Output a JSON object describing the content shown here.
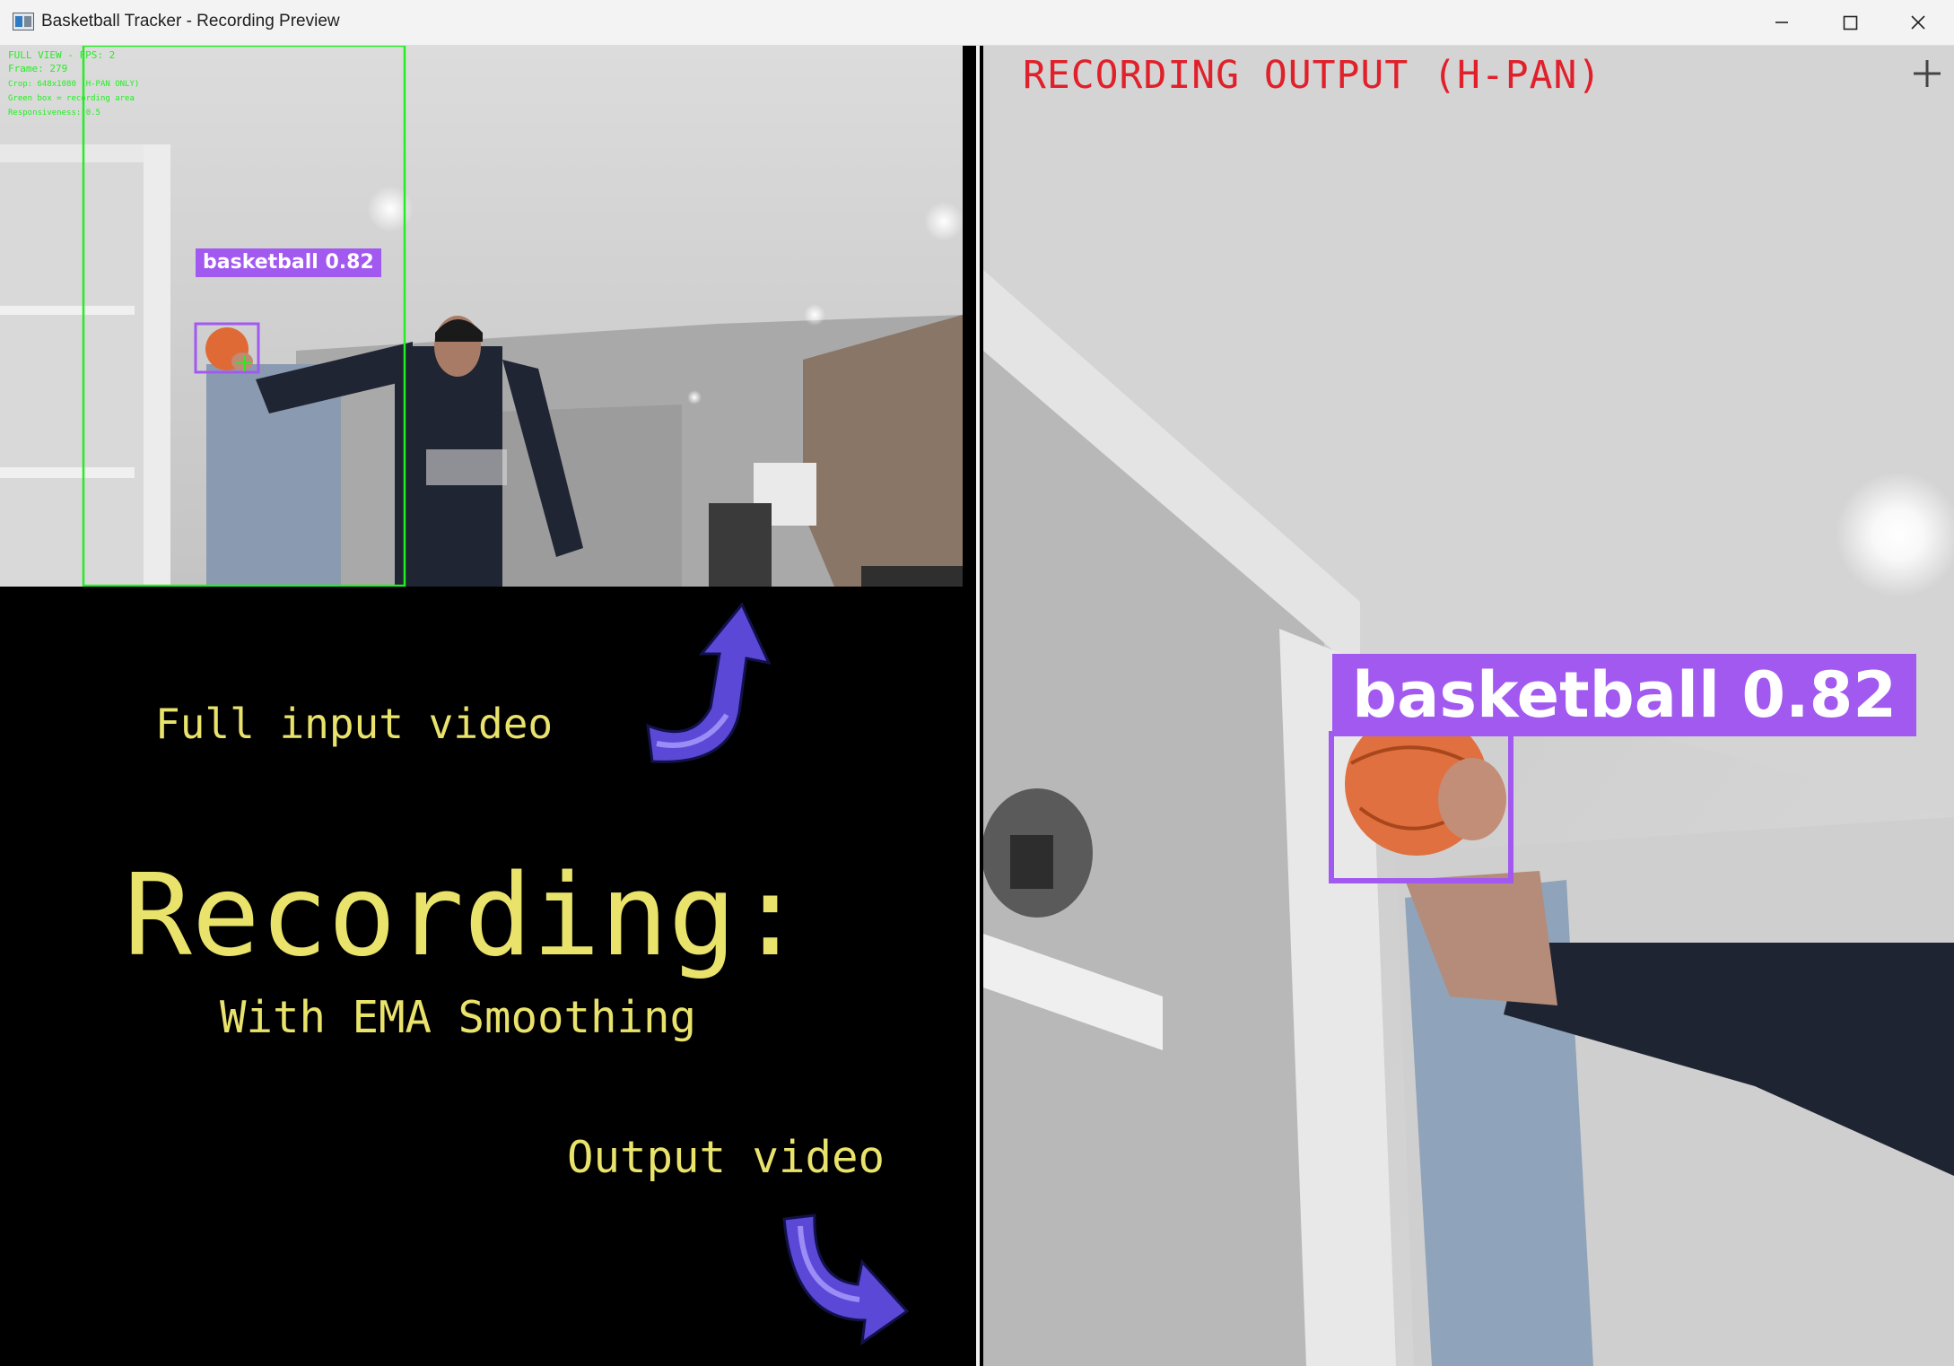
{
  "window": {
    "title": "Basketball Tracker - Recording Preview",
    "controls": [
      "minimize",
      "maximize",
      "close"
    ]
  },
  "left_view": {
    "hud_lines": [
      "FULL VIEW - FPS: 2",
      "Frame: 279",
      "Crop: 648x1080 (H-PAN ONLY)",
      "Green box = recording area",
      "Responsiveness: 0.5"
    ],
    "detection_label": "basketball 0.82"
  },
  "annotations": {
    "full_input": "Full input video",
    "recording": "Recording:",
    "subtitle": "With EMA Smoothing",
    "output": "Output video"
  },
  "right_view": {
    "header": "RECORDING OUTPUT (H-PAN)",
    "detection_label": "basketball 0.82"
  },
  "colors": {
    "annotation_text": "#e9e36c",
    "detection_box": "#a259f0",
    "recording_area_box": "#22ee22",
    "output_header": "#e0202a",
    "arrow": "#5b48d6"
  },
  "icons": [
    "app-icon",
    "minimize-icon",
    "maximize-icon",
    "close-icon",
    "crosshair-icon",
    "arrow-up-icon",
    "arrow-down-right-icon"
  ]
}
